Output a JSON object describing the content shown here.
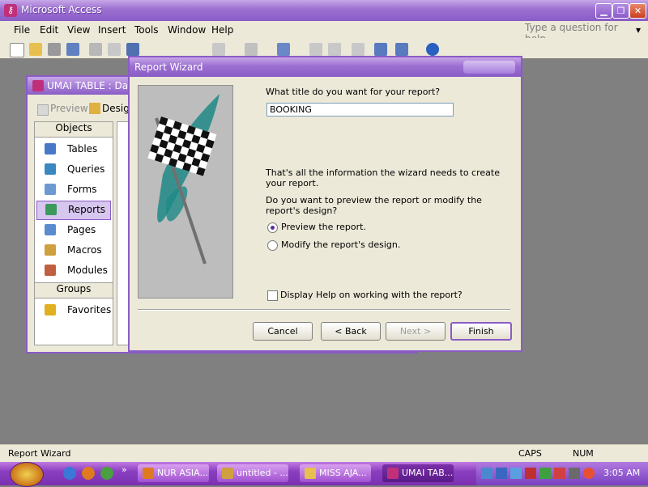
{
  "app": {
    "title": "Microsoft Access"
  },
  "menu": {
    "items": [
      "File",
      "Edit",
      "View",
      "Insert",
      "Tools",
      "Window",
      "Help"
    ],
    "ask_placeholder": "Type a question for help"
  },
  "db_window": {
    "title": "UMAI TABLE : Dat",
    "toolbar": {
      "preview": "Preview",
      "design": "Design"
    },
    "objects_header": "Objects",
    "objects": [
      "Tables",
      "Queries",
      "Forms",
      "Reports",
      "Pages",
      "Macros",
      "Modules"
    ],
    "groups_header": "Groups",
    "groups": [
      "Favorites"
    ]
  },
  "wizard": {
    "title": "Report Wizard",
    "title_prompt": "What title do you want for your report?",
    "title_value": "BOOKING",
    "info_text": "That's all the information the wizard needs to create your report.",
    "question": "Do you want to preview the report or modify the report's design?",
    "options": {
      "preview": "Preview the report.",
      "modify": "Modify the report's design.",
      "selected": "preview"
    },
    "help_checkbox": {
      "label": "Display Help on working with the report?",
      "checked": false
    },
    "buttons": {
      "cancel": "Cancel",
      "back": "< Back",
      "next": "Next >",
      "finish": "Finish"
    }
  },
  "status": {
    "text": "Report Wizard",
    "caps": "CAPS",
    "num": "NUM"
  },
  "taskbar": {
    "tasks": [
      "NUR ASIA...",
      "untitled - ...",
      "MISS AJA...",
      "UMAI TAB..."
    ],
    "clock": "3:05 AM"
  },
  "colors": {
    "accent": "#8a5cc6",
    "titlebar": "#9b6fd0"
  }
}
